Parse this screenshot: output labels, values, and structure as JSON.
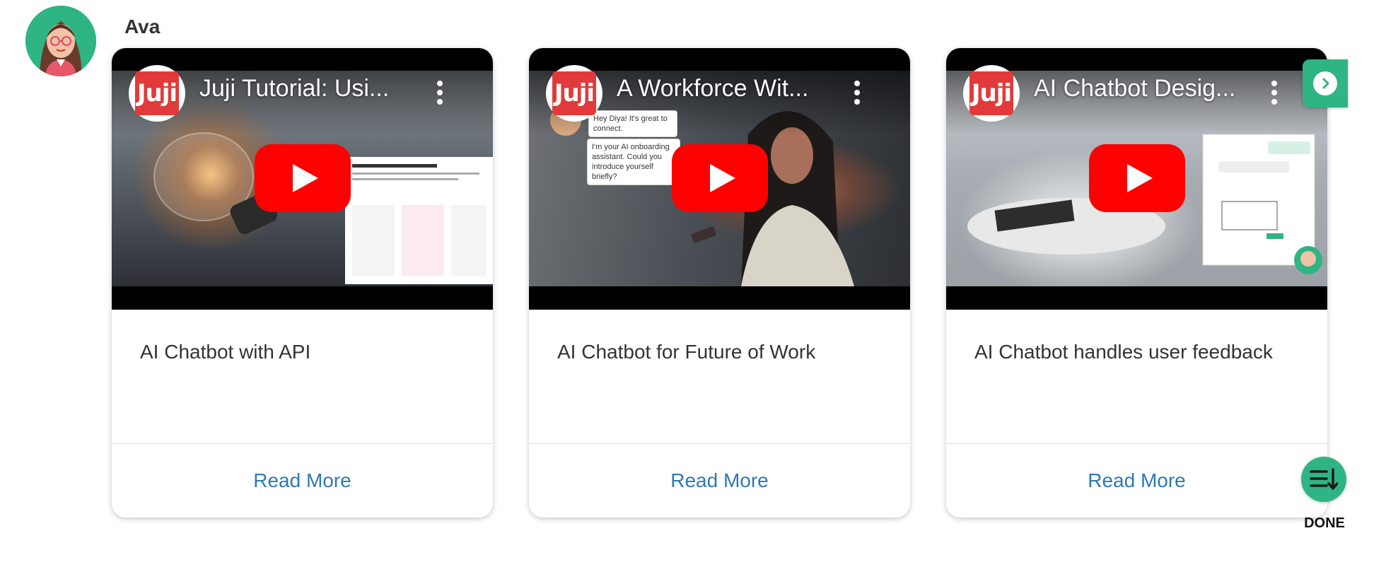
{
  "sender": {
    "name": "Ava"
  },
  "cards": [
    {
      "video_title": "Juji Tutorial: Usi...",
      "channel_logo_text": "Juji",
      "title": "AI Chatbot with API",
      "read_more": "Read More"
    },
    {
      "video_title": "A Workforce Wit...",
      "channel_logo_text": "Juji",
      "title": "AI Chatbot for Future of Work",
      "read_more": "Read More",
      "overlay_text": [
        "Hey Diya! It's great to connect.",
        "I'm your AI onboarding assistant. Could you introduce yourself briefly?"
      ]
    },
    {
      "video_title": "AI Chatbot Desig...",
      "channel_logo_text": "Juji",
      "title": "AI Chatbot handles user feedback",
      "read_more": "Read More"
    }
  ],
  "controls": {
    "done_label": "DONE"
  },
  "colors": {
    "accent_green": "#2fb483",
    "link_blue": "#2e78b7",
    "youtube_red": "#ff0000",
    "juji_red": "#e23a3a"
  },
  "icons": {
    "next": "chevron-right-circle-icon",
    "done": "list-sort-down-icon",
    "play": "youtube-play-icon",
    "menu": "more-vertical-icon"
  }
}
